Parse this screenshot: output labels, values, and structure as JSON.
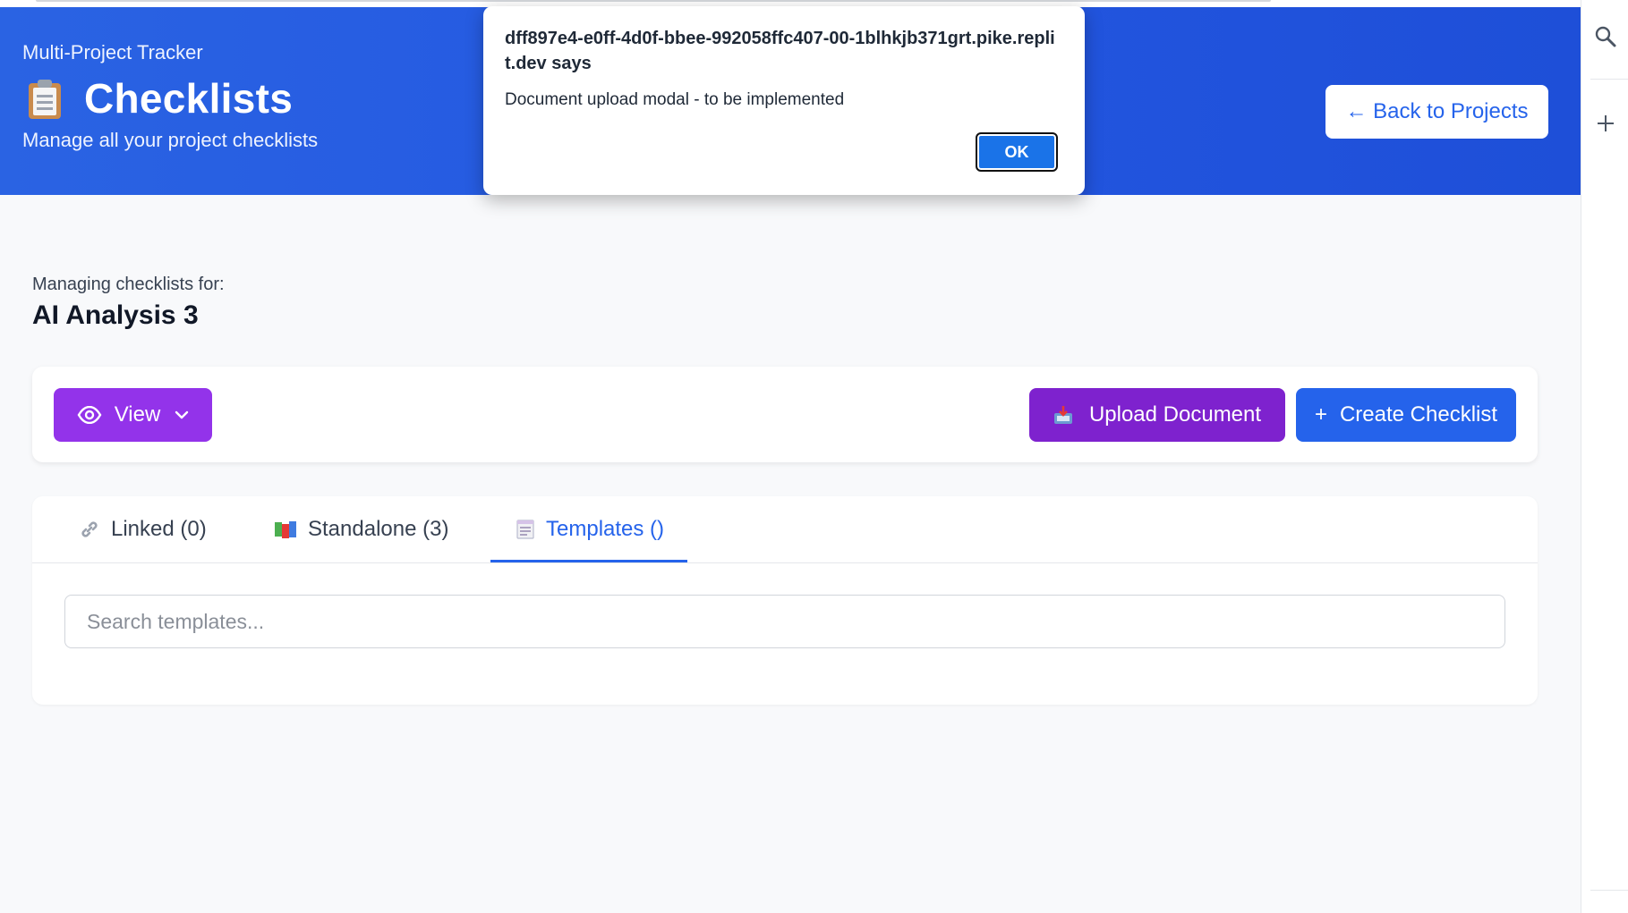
{
  "header": {
    "app_name": "Multi-Project Tracker",
    "title": "Checklists",
    "subtitle": "Manage all your project checklists",
    "back_button": "← Back to Projects",
    "title_icon": "clipboard-icon",
    "background_color": "#2563eb"
  },
  "project": {
    "label": "Managing checklists for:",
    "name": "AI Analysis 3"
  },
  "toolbar": {
    "view_label": "View",
    "upload_label": "Upload Document",
    "create_label": "Create Checklist",
    "create_prefix": "+",
    "view_color": "#9333ea",
    "upload_color": "#7e22ce",
    "create_color": "#2563eb"
  },
  "tabs": [
    {
      "label": "Linked (0)",
      "icon": "link-icon",
      "active": false
    },
    {
      "label": "Standalone (3)",
      "icon": "books-icon",
      "active": false
    },
    {
      "label": "Templates ()",
      "icon": "template-icon",
      "active": true
    }
  ],
  "search": {
    "placeholder": "Search templates...",
    "value": ""
  },
  "dialog": {
    "title": "dff897e4-e0ff-4d0f-bbee-992058ffc407-00-1blhkjb371grt.pike.replit.dev says",
    "message": "Document upload modal - to be implemented",
    "ok_label": "OK"
  },
  "browser_sidebar": {
    "icons": [
      "search-icon",
      "plus-icon"
    ]
  }
}
